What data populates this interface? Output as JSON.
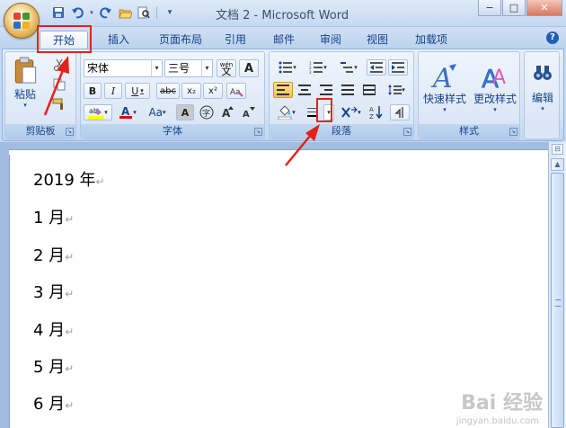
{
  "window": {
    "title": "文档 2 - Microsoft Word",
    "controls": {
      "minimize": "−",
      "maximize": "□",
      "close": "✕"
    }
  },
  "qat": {
    "icons": [
      "save-icon",
      "undo-icon",
      "redo-icon",
      "open-icon",
      "print-preview-icon",
      "customize-dropdown-icon"
    ]
  },
  "tabs": [
    "开始",
    "插入",
    "页面布局",
    "引用",
    "邮件",
    "审阅",
    "视图",
    "加载项"
  ],
  "active_tab": "开始",
  "help_label": "?",
  "ribbon": {
    "clipboard": {
      "label": "剪贴板",
      "paste": "粘贴"
    },
    "font": {
      "label": "字体",
      "font_name": "宋体",
      "font_size": "三号",
      "wen_icon_label": "wén",
      "A_label": "A",
      "bold": "B",
      "italic": "I",
      "underline": "U",
      "strike": "abc",
      "sub": "x₂",
      "sup": "x²",
      "clear": "Aa",
      "grow": "A",
      "shrink": "A",
      "circled": "字"
    },
    "paragraph": {
      "label": "段落"
    },
    "styles": {
      "label": "样式",
      "quick": "快速样式",
      "change": "更改样式"
    },
    "editing": {
      "label": "编辑"
    }
  },
  "document": {
    "lines": [
      "2019 年",
      "1 月",
      "2 月",
      "3 月",
      "4 月",
      "5 月",
      "6 月"
    ],
    "para_mark": "↵"
  },
  "watermark": {
    "text": "Bai 经验",
    "sub": "jingyan.baidu.com"
  },
  "colors": {
    "annotation_red": "#e8201a",
    "ribbon_blue": "#15428b",
    "font_color_red": "#e00000",
    "highlight_yellow": "#ffff00"
  }
}
